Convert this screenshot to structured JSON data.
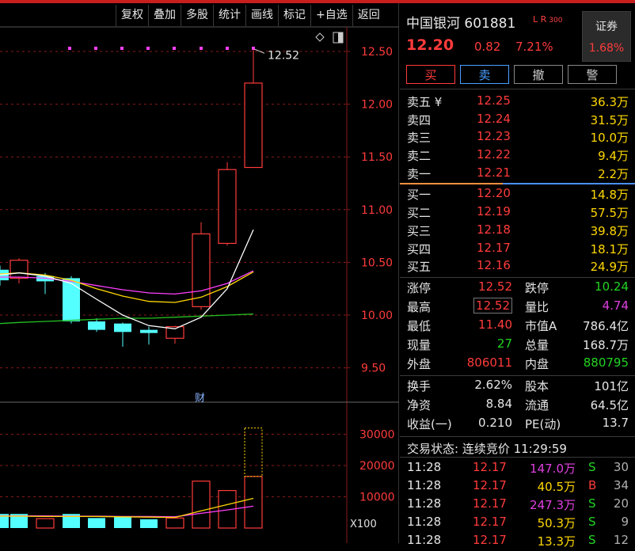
{
  "toolbar": [
    "复权",
    "叠加",
    "多股",
    "统计",
    "画线",
    "标记",
    "+自选",
    "返回"
  ],
  "chart": {
    "price_axis": [
      "12.50",
      "12.00",
      "11.50",
      "11.00",
      "10.50",
      "10.00",
      "9.50"
    ],
    "vol_axis": [
      "30000",
      "20000",
      "10000"
    ],
    "vol_unit": "X100",
    "high_label": "12.52",
    "cai_label": "财",
    "colors": {
      "up": "#ff3b3b",
      "down": "#54ffff",
      "ma1": "#ffffff",
      "ma2": "#ffd800",
      "ma3": "#ff40ff",
      "ma4": "#22c022",
      "grid": "#8a1a1a"
    }
  },
  "stock": {
    "name": "中国银河",
    "code": "601881",
    "lr": "L R",
    "lr_sub": "300",
    "sector_label": "证券",
    "sector_pct": "1.68%",
    "price": "12.20",
    "change": "0.82",
    "pct": "7.21%"
  },
  "buttons": {
    "buy": "买",
    "sell": "卖",
    "cancel": "撤",
    "alert": "警"
  },
  "asks": [
    {
      "label": "卖五 ¥",
      "price": "12.25",
      "vol": "36.3万"
    },
    {
      "label": "卖四",
      "price": "12.24",
      "vol": "31.5万"
    },
    {
      "label": "卖三",
      "price": "12.23",
      "vol": "10.0万"
    },
    {
      "label": "卖二",
      "price": "12.22",
      "vol": "9.4万"
    },
    {
      "label": "卖一",
      "price": "12.21",
      "vol": "2.2万"
    }
  ],
  "bids": [
    {
      "label": "买一",
      "price": "12.20",
      "vol": "14.8万"
    },
    {
      "label": "买二",
      "price": "12.19",
      "vol": "57.5万"
    },
    {
      "label": "买三",
      "price": "12.18",
      "vol": "39.8万"
    },
    {
      "label": "买四",
      "price": "12.17",
      "vol": "18.1万"
    },
    {
      "label": "买五",
      "price": "12.16",
      "vol": "24.9万"
    }
  ],
  "quote": {
    "limit_up_l": "涨停",
    "limit_up": "12.52",
    "limit_down_l": "跌停",
    "limit_down": "10.24",
    "high_l": "最高",
    "high": "12.52",
    "vol_ratio_l": "量比",
    "vol_ratio": "4.74",
    "low_l": "最低",
    "low": "11.40",
    "mktcap_l": "市值A",
    "mktcap": "786.4亿",
    "cur_l": "现量",
    "cur": "27",
    "total_l": "总量",
    "total": "168.7万",
    "outer_l": "外盘",
    "outer": "806011",
    "inner_l": "内盘",
    "inner": "880795",
    "turnover_l": "换手",
    "turnover": "2.62%",
    "capital_l": "股本",
    "capital": "101亿",
    "nav_l": "净资",
    "nav": "8.84",
    "float_l": "流通",
    "float": "64.5亿",
    "eps_l": "收益(一)",
    "eps": "0.210",
    "pe_l": "PE(动)",
    "pe": "13.7"
  },
  "status": "交易状态: 连续竞价 11:29:59",
  "ticks": [
    {
      "time": "11:28",
      "price": "12.17",
      "vol": "147.0万",
      "side": "S",
      "n": "30"
    },
    {
      "time": "11:28",
      "price": "12.17",
      "vol": "40.5万",
      "side": "B",
      "n": "34"
    },
    {
      "time": "11:28",
      "price": "12.17",
      "vol": "247.3万",
      "side": "S",
      "n": "20"
    },
    {
      "time": "11:28",
      "price": "12.17",
      "vol": "50.3万",
      "side": "S",
      "n": "9"
    },
    {
      "time": "11:28",
      "price": "12.17",
      "vol": "13.3万",
      "side": "S",
      "n": "12"
    }
  ]
}
